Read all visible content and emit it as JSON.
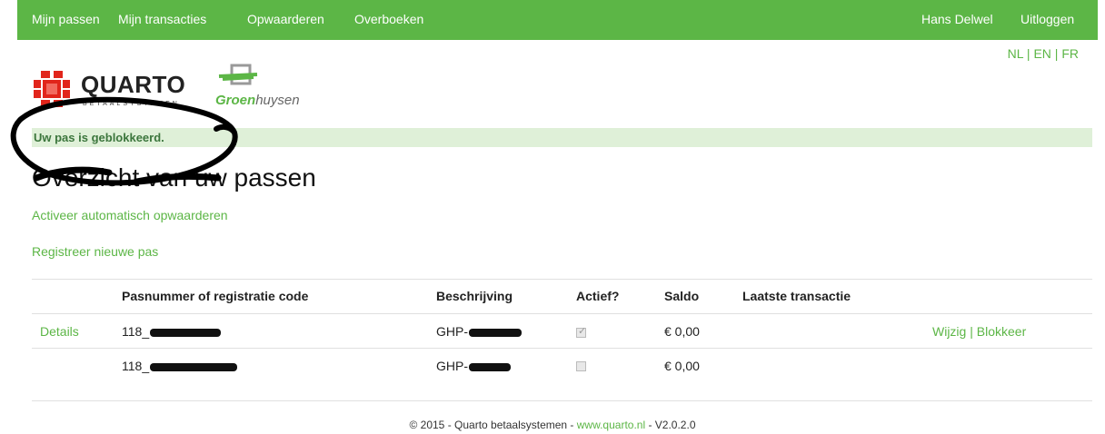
{
  "nav": {
    "left": [
      "Mijn passen",
      "Mijn transacties",
      "Opwaarderen",
      "Overboeken"
    ],
    "user": "Hans Delwel",
    "logout": "Uitloggen",
    "color": "#5cb646"
  },
  "lang": {
    "nl": "NL",
    "en": "EN",
    "fr": "FR",
    "sep": "|"
  },
  "logos": {
    "quarto_word": "QUARTO",
    "quarto_tag": "BETAALSYSTEMEN",
    "groen_part1": "Groen",
    "groen_part2": "huysen"
  },
  "alert": {
    "text": "Uw pas is geblokkeerd.",
    "bg": "#dff0d8",
    "color": "#3c763d"
  },
  "page_title": "Overzicht van uw passen",
  "links": {
    "auto_topup": "Activeer automatisch opwaarderen",
    "register": "Registreer nieuwe pas"
  },
  "table": {
    "headers": [
      "Pasnummer of registratie code",
      "Beschrijving",
      "Actief?",
      "Saldo",
      "Laatste transactie"
    ],
    "rows": [
      {
        "details": "Details",
        "pasnummer": "118_",
        "beschrijving": "GHP-",
        "actief": true,
        "saldo": "€ 0,00",
        "laatste": "",
        "wijzig": "Wijzig",
        "sep": "|",
        "blokkeer": "Blokkeer"
      },
      {
        "details": "",
        "pasnummer": "118_",
        "beschrijving": "GHP-",
        "actief": false,
        "saldo": "€ 0,00",
        "laatste": ""
      }
    ]
  },
  "footer": {
    "prefix": "© 2015 - Quarto betaalsystemen - ",
    "link": "www.quarto.nl",
    "suffix": " - V2.0.2.0"
  }
}
